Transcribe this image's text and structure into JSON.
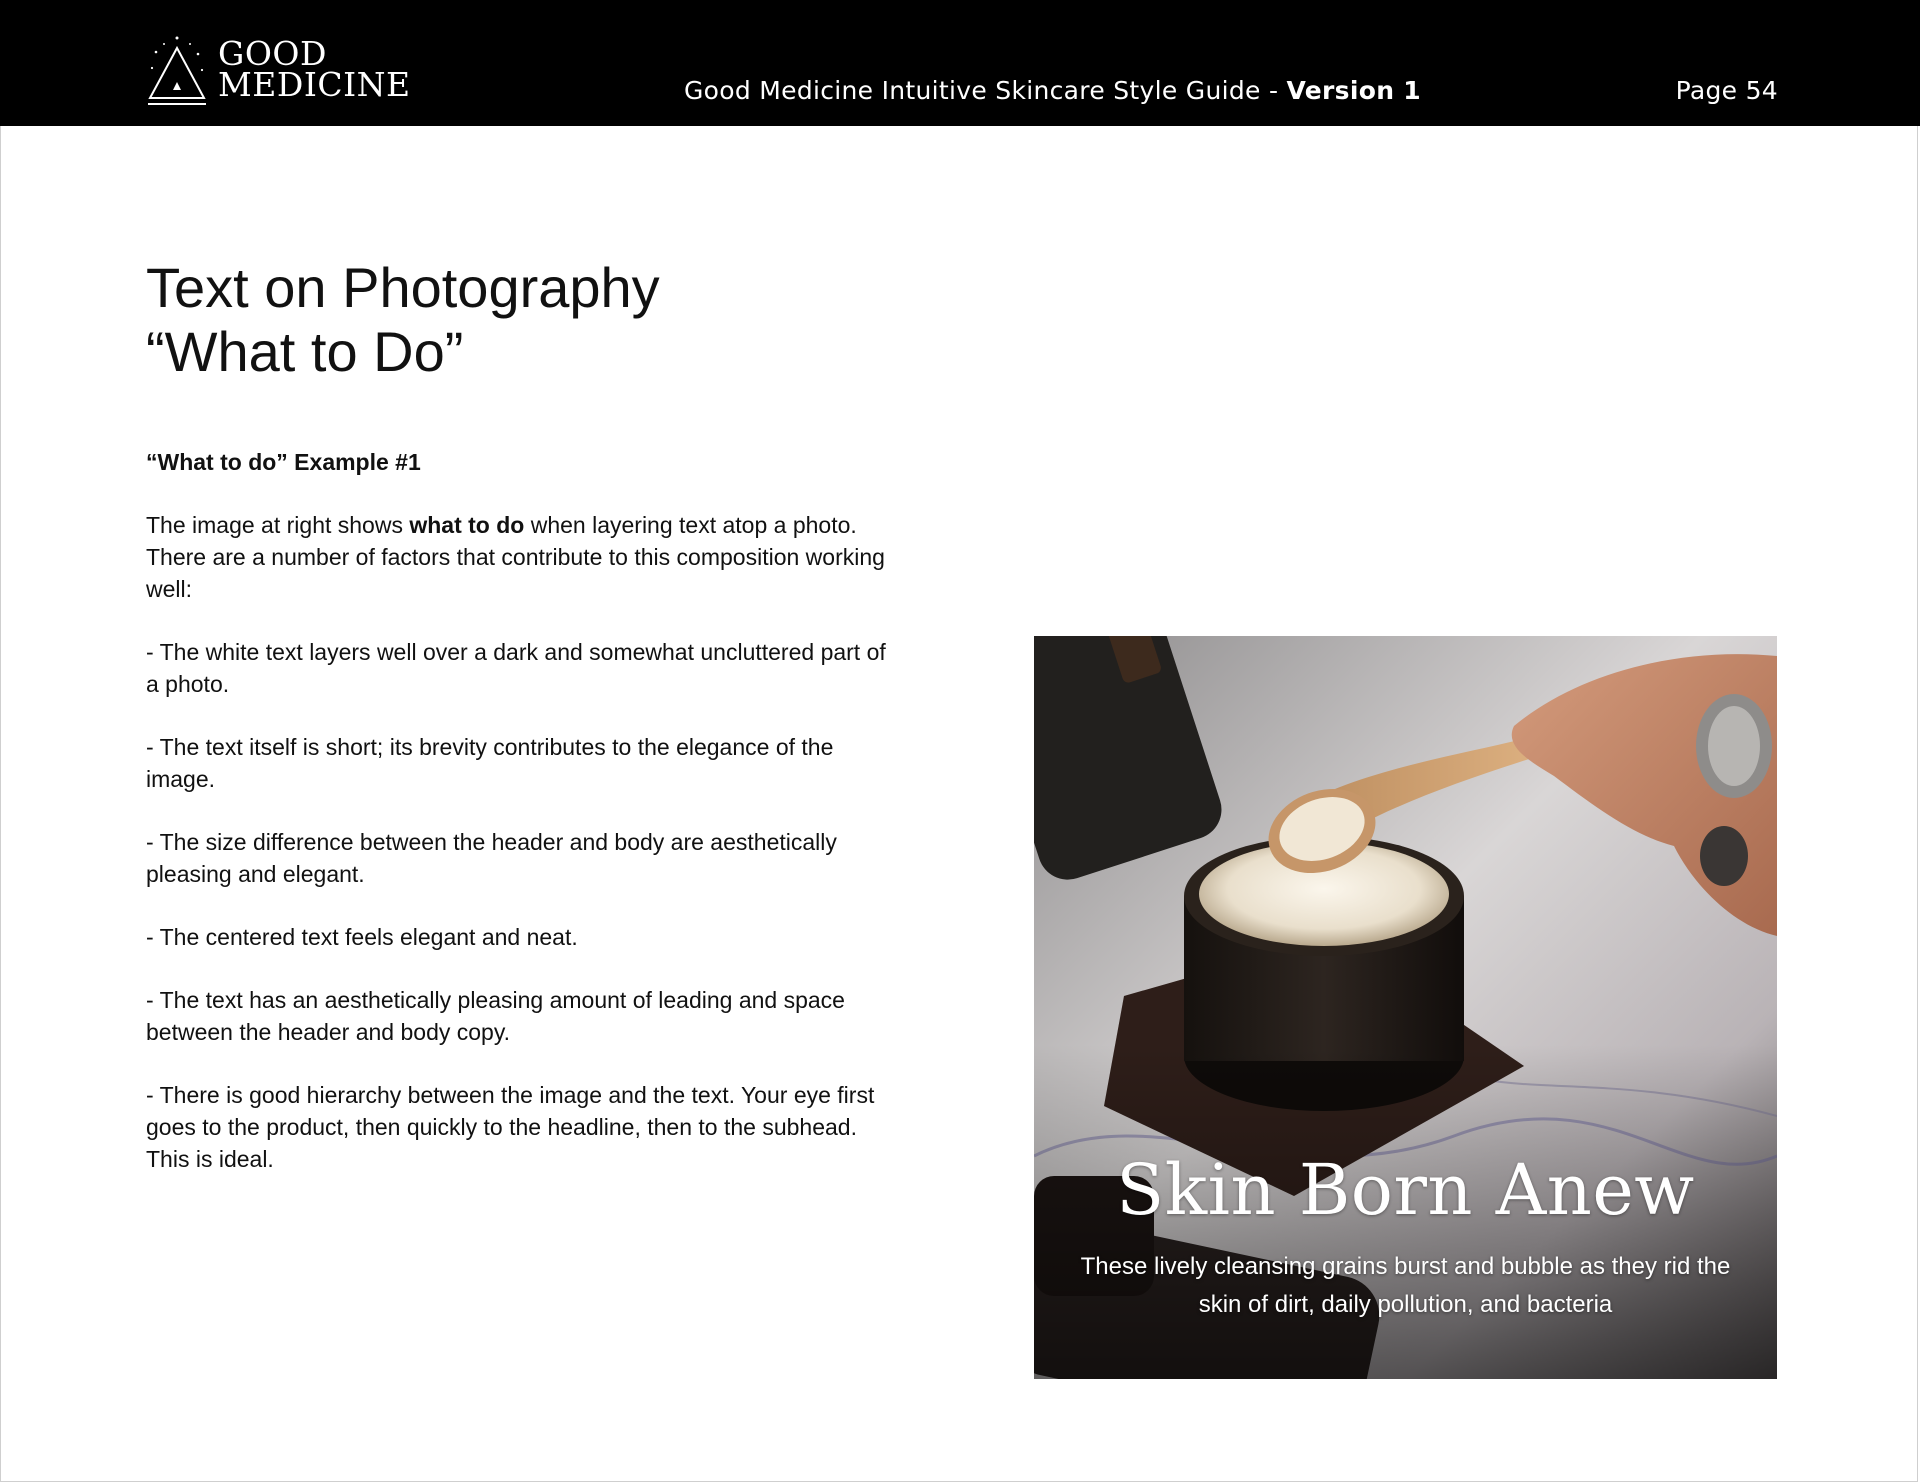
{
  "header": {
    "logo": {
      "line1": "GOOD",
      "line2": "MEDICINE",
      "icon": "triangle-sparkle-icon"
    },
    "title_main": "Good Medicine Intuitive Skincare Style Guide - ",
    "title_version": "Version 1",
    "page_label": "Page 54"
  },
  "content": {
    "title_line1": "Text on Photography",
    "title_line2": "“What to Do”",
    "example_heading": "“What to do” Example #1",
    "intro": {
      "before": "The image at right shows ",
      "bold": "what to do",
      "after": " when layering text atop a photo. There are a number of factors that contribute to this composition working well:"
    },
    "points": [
      "- The white text layers well over a dark and somewhat uncluttered part of a photo.",
      "- The text itself is short; its brevity contributes to the elegance of the image.",
      "- The size difference between the header and body are aesthetically pleasing and elegant.",
      "- The centered text feels elegant and neat.",
      "- The text has an aesthetically pleasing amount of leading and space between the header and body copy.",
      "- There is good hierarchy between the image and the text. Your eye first goes to the product, then quickly to the headline, then to the subhead. This is ideal."
    ]
  },
  "photo": {
    "headline": "Skin Born Anew",
    "subhead": "These lively cleansing grains burst and bubble as they rid the skin of dirt, daily pollution, and bacteria"
  },
  "colors": {
    "header_bg": "#000000",
    "header_text": "#ffffff",
    "body_text": "#111111",
    "page_bg": "#ffffff"
  }
}
